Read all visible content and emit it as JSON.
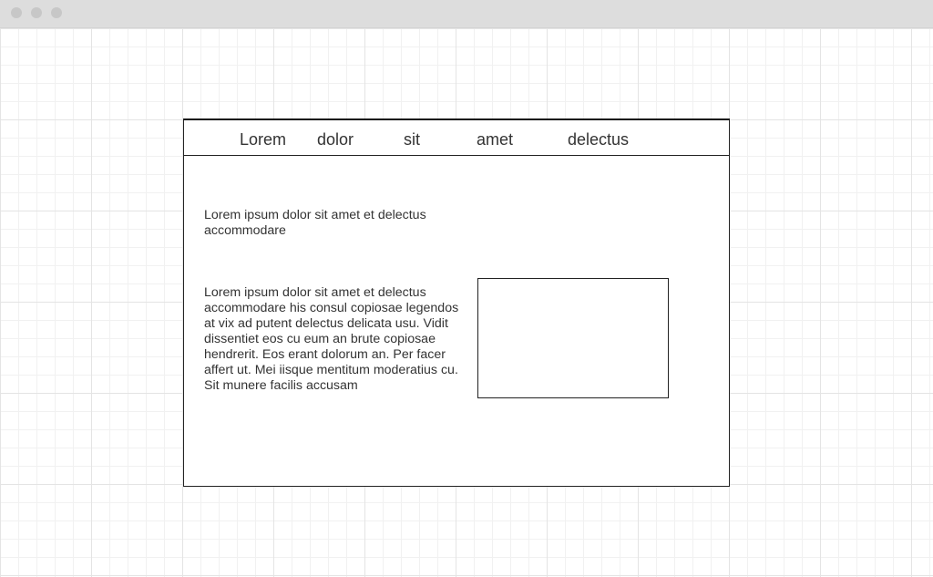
{
  "nav": {
    "items": [
      {
        "label": "Lorem"
      },
      {
        "label": "dolor"
      },
      {
        "label": "sit"
      },
      {
        "label": "amet"
      },
      {
        "label": "delectus"
      }
    ]
  },
  "content": {
    "intro": "Lorem ipsum dolor sit amet et delectus accommodare",
    "body": "Lorem ipsum dolor sit amet et delectus accommodare his consul copiosae legendos at vix ad putent delectus delicata usu. Vidit dissentiet eos cu eum an brute copiosae hendrerit. Eos erant dolorum an. Per facer affert ut. Mei iisque mentitum moderatius cu. Sit munere facilis accusam"
  }
}
